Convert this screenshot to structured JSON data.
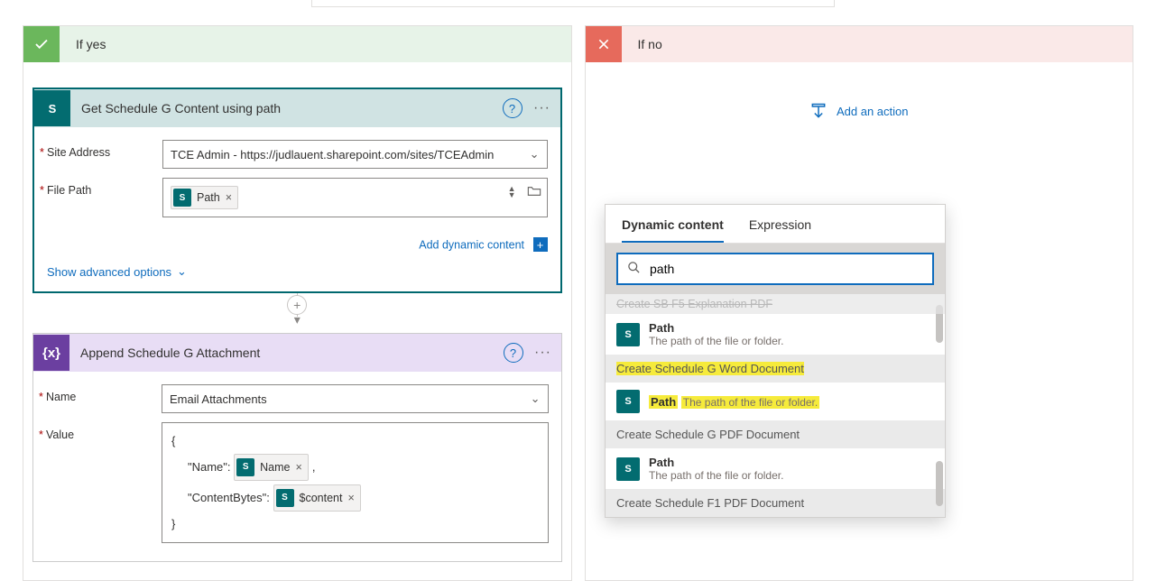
{
  "condition": {
    "yes_label": "If yes",
    "no_label": "If no"
  },
  "card1": {
    "title": "Get Schedule G Content using path",
    "fields": {
      "site_label": "Site Address",
      "site_value": "TCE Admin - https://judlauent.sharepoint.com/sites/TCEAdmin",
      "path_label": "File Path",
      "path_token": "Path"
    },
    "add_dynamic": "Add dynamic content",
    "advanced": "Show advanced options"
  },
  "card2": {
    "title": "Append Schedule G Attachment",
    "fields": {
      "name_label": "Name",
      "name_value": "Email Attachments",
      "value_label": "Value",
      "json_key_name": "\"Name\":",
      "json_key_cb": "\"ContentBytes\":",
      "token_name": "Name",
      "token_content": "$content"
    }
  },
  "add_action": "Add an action",
  "flyout": {
    "tab_dynamic": "Dynamic content",
    "tab_expr": "Expression",
    "search_value": "path",
    "cut_group": "Create SB F5 Explanation PDF",
    "item_path_title": "Path",
    "item_path_desc": "The path of the file or folder.",
    "group_g_word": "Create Schedule G Word Document",
    "group_g_pdf": "Create Schedule G PDF Document",
    "group_f1_pdf": "Create Schedule F1 PDF Document"
  }
}
